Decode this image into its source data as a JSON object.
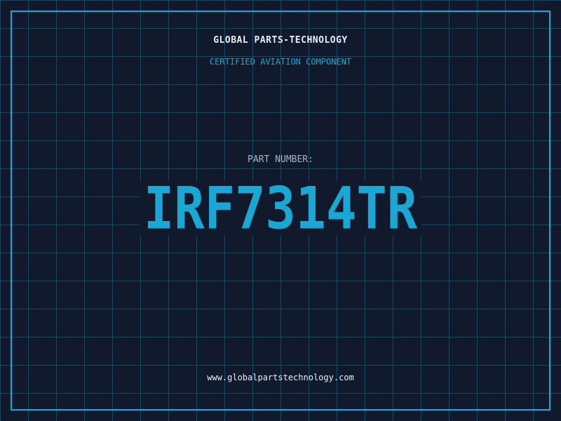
{
  "header": {
    "company": "GLOBAL PARTS-TECHNOLOGY",
    "tagline": "CERTIFIED AVIATION COMPONENT"
  },
  "part": {
    "label": "PART NUMBER:",
    "number": "IRF7314TR"
  },
  "footer": {
    "website": "www.globalpartstechnology.com"
  },
  "theme": {
    "background": "#111a2d",
    "grid": "#1e4660",
    "accent": "#1aa7d4",
    "text": "#e8eef5",
    "muted": "#a8b3c5"
  }
}
